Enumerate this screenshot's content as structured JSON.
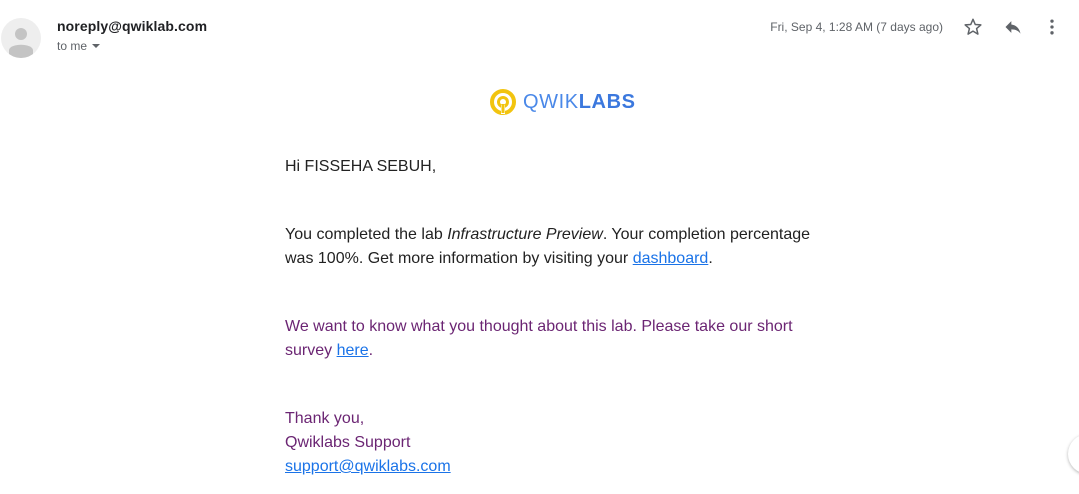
{
  "header": {
    "sender_email": "noreply@qwiklab.com",
    "recipient_label": "to me",
    "date_label": "Fri, Sep 4, 1:28 AM (7 days ago)",
    "icons": [
      "person-icon",
      "chevron-down-icon",
      "star-icon",
      "reply-icon",
      "more-vert-icon"
    ]
  },
  "logo": {
    "text_part1": "QWIK",
    "text_part2": "LABS",
    "ring_color": "#f2c40f",
    "text_color": "#4285f4"
  },
  "email": {
    "greeting": "Hi FISSEHA SEBUH,",
    "completed_prefix": "You completed the lab ",
    "lab_name": "Infrastructure Preview",
    "completed_mid": ". Your completion percentage was 100%. Get more information by visiting your ",
    "dashboard_link": "dashboard",
    "completed_end": ".",
    "survey_text": "We want to know what you thought about this lab. Please take our short survey ",
    "survey_link": "here",
    "survey_end": ".",
    "thanks": "Thank you,",
    "team": "Qwiklabs Support",
    "support_email": "support@qwiklabs.com"
  },
  "colors": {
    "link": "#1a73e8",
    "quoted_text": "#6b2573",
    "muted": "#5f6368"
  }
}
